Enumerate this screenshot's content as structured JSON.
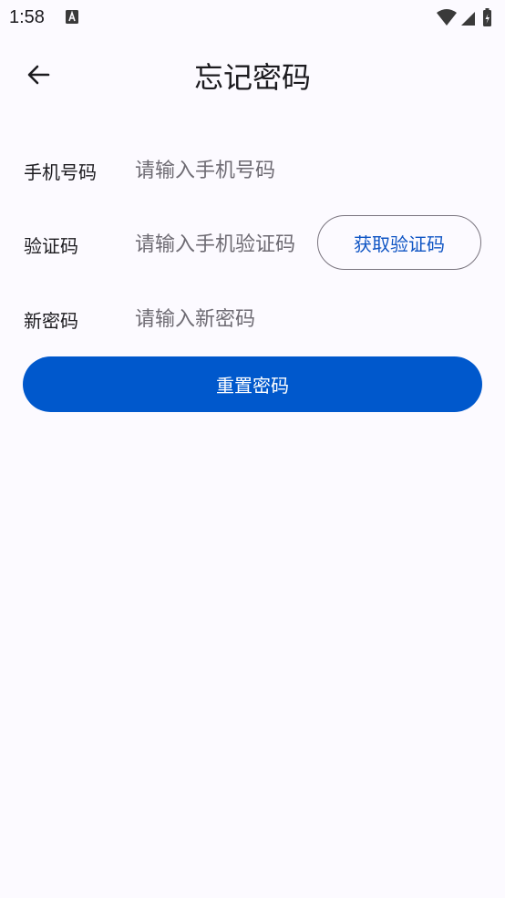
{
  "status_bar": {
    "time": "1:58"
  },
  "header": {
    "title": "忘记密码",
    "back_icon": "arrow-left-icon"
  },
  "form": {
    "phone": {
      "label": "手机号码",
      "placeholder": "请输入手机号码",
      "value": ""
    },
    "code": {
      "label": "验证码",
      "placeholder": "请输入手机验证码",
      "value": "",
      "get_code_label": "获取验证码"
    },
    "new_password": {
      "label": "新密码",
      "placeholder": "请输入新密码",
      "value": ""
    },
    "submit_label": "重置密码"
  },
  "colors": {
    "background": "#fcfaff",
    "primary": "#0058cc",
    "link": "#0f55c4",
    "outline": "#79747e"
  }
}
